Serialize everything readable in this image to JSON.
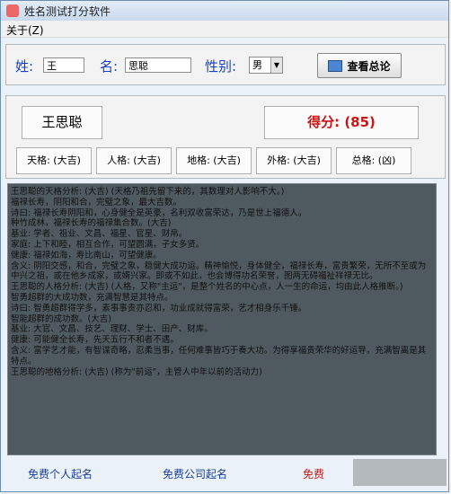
{
  "window": {
    "title": "姓名测试打分软件"
  },
  "menu": {
    "about": "关于(Z)"
  },
  "form": {
    "surname_label": "姓:",
    "surname_value": "王",
    "name_label": "名:",
    "name_value": "思聪",
    "gender_label": "性别:",
    "gender_value": "男",
    "check_button": "查看总论"
  },
  "result": {
    "full_name": "王思聪",
    "score": "得分: (85)",
    "grids": [
      "天格: (大吉)",
      "人格: (大吉)",
      "地格: (大吉)",
      "外格: (大吉)",
      "总格: (凶)"
    ]
  },
  "analysis": [
    "王思聪的天格分析: (大吉) (天格乃祖先留下来的，其数理对人影响不大。)",
    "",
    "福禄长寿，阴阳和合，完璧之象，最大吉数。",
    "诗曰: 福禄长寿阴阳和，心身健全是英豪，名利双收富荣达，乃是世上福德人。",
    "",
    "种竹成林，福禄长寿的福禄集合数。(大吉)",
    "基业: 学者、祖业、文昌、福星、官星、财帛。",
    "家庭: 上下和睦，相互合作，可望圆满，子女多贤。",
    "健康: 福禄如海，寿比南山，可望健康。",
    "含义: 阴阳交感，和合，完璧之象，稳健大成功运。精神愉悦，身体健全，福禄长寿，富贵繁荣，无所不至或为中兴之祖，或在他乡成家，或婿兴家。即或不如此，也会博得功名荣誉，图两无碍福祉祥禄无比。",
    "",
    "王思聪的人格分析: (大吉) (人格，又称\"主运\"，是整个姓名的中心点，人一生的命运，均由此人格推断。)",
    "",
    "智勇超群的大成功数，充满智慧是其特点。",
    "诗曰: 智勇超群得学多，素事事贵亦忍和，功业成就得富荣，艺才相身乐千锤。",
    "",
    "智能超群的成功数。(大吉)",
    "基业: 大官、文昌、技艺、理财、学士、田产、财库。",
    "健康: 可能健全长寿，先天五行不和者不遇。",
    "含义: 富学艺才能，有智谋奇略，忍柔当事，任何难事皆巧于奏大功。为得享福贵荣华的好运导，充满智离是其特点。",
    "",
    "王思聪的地格分析: (大吉) (称为\"前运\"，主管人中年以前的活动力)"
  ],
  "footer": {
    "link1": "免费个人起名",
    "link2": "免费公司起名",
    "link3": "免费"
  }
}
